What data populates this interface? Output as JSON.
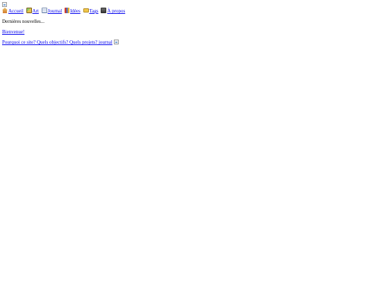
{
  "header": {
    "logo_alt": "logo"
  },
  "nav": {
    "items": [
      {
        "label": "Accueil",
        "icon": "home-icon"
      },
      {
        "label": "Art",
        "icon": "art-icon"
      },
      {
        "label": "Journal",
        "icon": "journal-icon"
      },
      {
        "label": "Idées",
        "icon": "ideas-icon"
      },
      {
        "label": "Tags",
        "icon": "tags-icon"
      },
      {
        "label": "À propos",
        "icon": "about-icon"
      }
    ]
  },
  "main": {
    "subtitle": "Dernières nouvelles...",
    "posts": [
      {
        "title": "Bienvenue!"
      },
      {
        "title": "Pourquoi ce site? Quels objectifs? Quels projets? journal"
      }
    ]
  },
  "colors": {
    "link": "#0000ee",
    "text": "#000000",
    "background": "#ffffff"
  }
}
